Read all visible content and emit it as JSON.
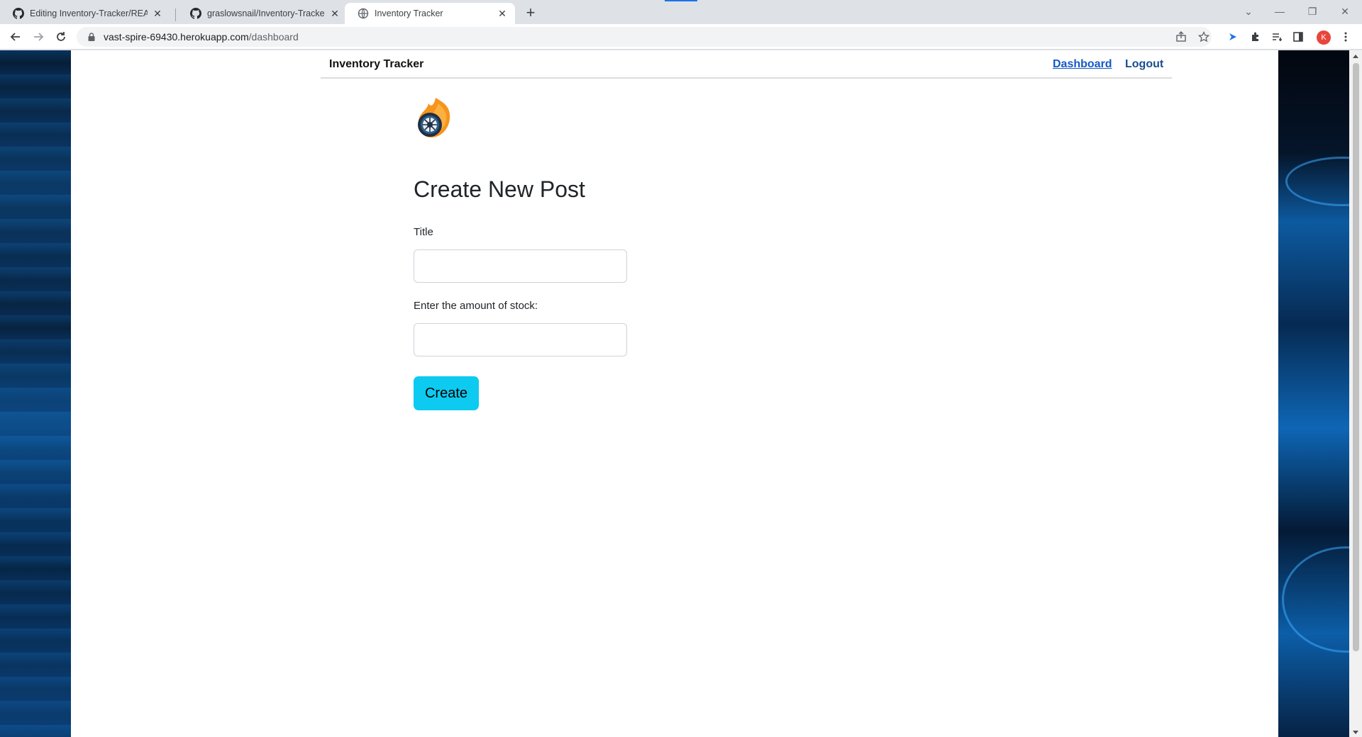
{
  "browser": {
    "tabs": [
      {
        "title": "Editing Inventory-Tracker/READM",
        "icon": "github-icon",
        "active": false
      },
      {
        "title": "graslowsnail/Inventory-Tracker",
        "icon": "github-icon",
        "active": false
      },
      {
        "title": "Inventory Tracker",
        "icon": "globe-icon",
        "active": true
      }
    ],
    "new_tab": "+",
    "url_host": "vast-spire-69430.herokuapp.com",
    "url_path": "/dashboard",
    "profile_initial": "K",
    "profile_color": "#e8453c"
  },
  "site": {
    "brand": "Inventory Tracker",
    "nav": {
      "dashboard": "Dashboard",
      "logout": "Logout"
    },
    "heading": "Create New Post",
    "form": {
      "title_label": "Title",
      "title_value": "",
      "stock_label": "Enter the amount of stock:",
      "stock_value": "",
      "submit": "Create"
    },
    "accent": "#0dcaf0",
    "link_color": "#1559c4"
  }
}
